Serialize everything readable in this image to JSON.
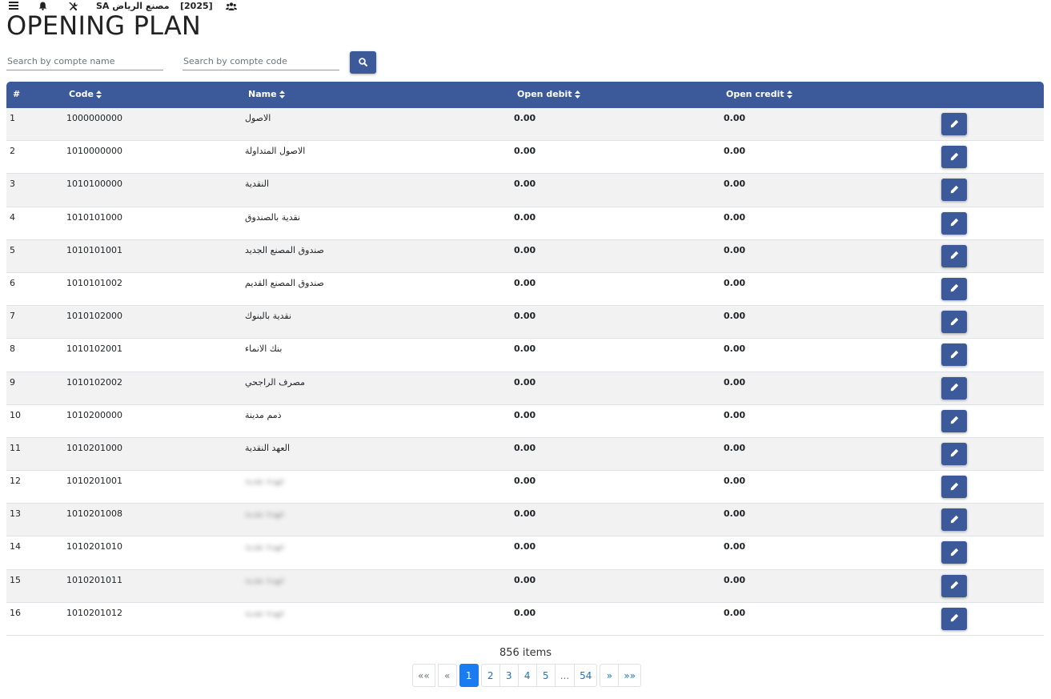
{
  "topbar": {
    "company": "SA مصنع الرياض",
    "year": "[2025]",
    "icons": [
      "menu-icon",
      "bell-icon",
      "tools-icon",
      "users-icon"
    ]
  },
  "page": {
    "title": "OPENING PLAN"
  },
  "search": {
    "name_placeholder": "Search by compte name",
    "code_placeholder": "Search by compte code"
  },
  "table": {
    "columns": {
      "index": "#",
      "code": "Code",
      "name": "Name",
      "open_debit": "Open debit",
      "open_credit": "Open credit"
    },
    "rows": [
      {
        "index": "1",
        "code": "1000000000",
        "name": "الاصول",
        "debit": "0.00",
        "credit": "0.00",
        "blurred": false
      },
      {
        "index": "2",
        "code": "1010000000",
        "name": "الاصول المتداولة",
        "debit": "0.00",
        "credit": "0.00",
        "blurred": false
      },
      {
        "index": "3",
        "code": "1010100000",
        "name": "النقدية",
        "debit": "0.00",
        "credit": "0.00",
        "blurred": false
      },
      {
        "index": "4",
        "code": "1010101000",
        "name": "نقدية بالصندوق",
        "debit": "0.00",
        "credit": "0.00",
        "blurred": false
      },
      {
        "index": "5",
        "code": "1010101001",
        "name": "صندوق المصنع الجديد",
        "debit": "0.00",
        "credit": "0.00",
        "blurred": false
      },
      {
        "index": "6",
        "code": "1010101002",
        "name": "صندوق المصنع القديم",
        "debit": "0.00",
        "credit": "0.00",
        "blurred": false
      },
      {
        "index": "7",
        "code": "1010102000",
        "name": "نقدية بالبنوك",
        "debit": "0.00",
        "credit": "0.00",
        "blurred": false
      },
      {
        "index": "8",
        "code": "1010102001",
        "name": "بنك الانماء",
        "debit": "0.00",
        "credit": "0.00",
        "blurred": false
      },
      {
        "index": "9",
        "code": "1010102002",
        "name": "مصرف الراجحي",
        "debit": "0.00",
        "credit": "0.00",
        "blurred": false
      },
      {
        "index": "10",
        "code": "1010200000",
        "name": "ذمم مدينة",
        "debit": "0.00",
        "credit": "0.00",
        "blurred": false
      },
      {
        "index": "11",
        "code": "1010201000",
        "name": "العهد النقدية",
        "debit": "0.00",
        "credit": "0.00",
        "blurred": false
      },
      {
        "index": "12",
        "code": "1010201001",
        "name": "عهدة نقدية",
        "debit": "0.00",
        "credit": "0.00",
        "blurred": true
      },
      {
        "index": "13",
        "code": "1010201008",
        "name": "عهدة نقدية",
        "debit": "0.00",
        "credit": "0.00",
        "blurred": true
      },
      {
        "index": "14",
        "code": "1010201010",
        "name": "عهدة نقدية",
        "debit": "0.00",
        "credit": "0.00",
        "blurred": true
      },
      {
        "index": "15",
        "code": "1010201011",
        "name": "عهدة نقدية",
        "debit": "0.00",
        "credit": "0.00",
        "blurred": true
      },
      {
        "index": "16",
        "code": "1010201012",
        "name": "عهدة نقدية",
        "debit": "0.00",
        "credit": "0.00",
        "blurred": true
      }
    ]
  },
  "footer": {
    "items_count": "856 items",
    "pagination": {
      "first": "««",
      "prev": "«",
      "pages": [
        "1",
        "2",
        "3",
        "4",
        "5"
      ],
      "ellipsis": "...",
      "last_page": "54",
      "next": "»",
      "last": "»»",
      "active": "1"
    }
  },
  "colors": {
    "header_bg": "#3c5a99",
    "button_bg": "#3c5a99",
    "active_page": "#1a7cf0",
    "link": "#1a73c8",
    "stripe": "#f2f2f2"
  }
}
